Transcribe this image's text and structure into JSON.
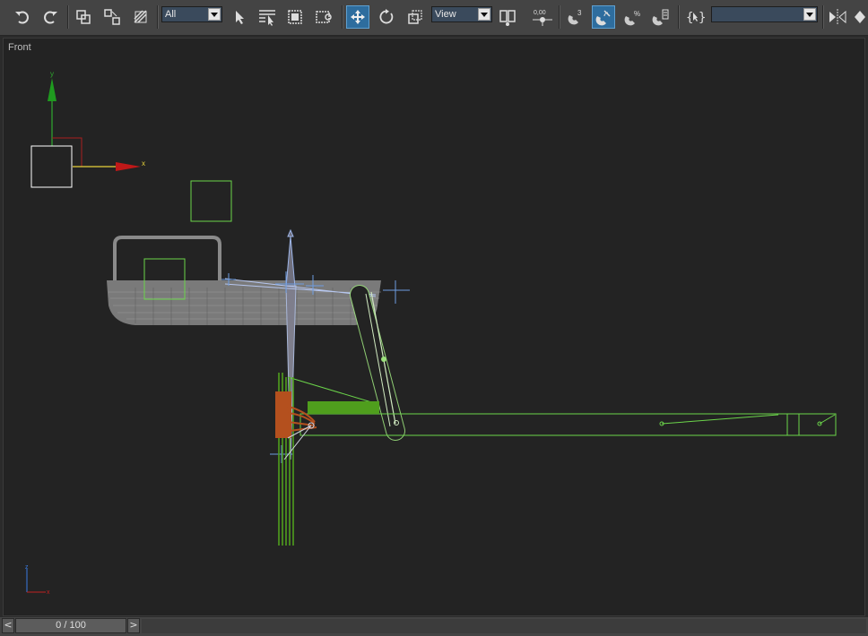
{
  "toolbar": {
    "selection_filter": "All",
    "reference_coord": "View",
    "spinner_value": "0,00",
    "named_selection": "",
    "items": [
      {
        "id": "undo",
        "icon": "undo-icon"
      },
      {
        "id": "redo",
        "icon": "redo-icon"
      },
      {
        "id": "link",
        "icon": "link-icon"
      },
      {
        "id": "unlink",
        "icon": "unlink-icon"
      },
      {
        "id": "bind-space-warp",
        "icon": "bind-space-warp-icon"
      },
      {
        "id": "select-object",
        "icon": "select-arrow-icon"
      },
      {
        "id": "select-by-name",
        "icon": "select-by-name-icon"
      },
      {
        "id": "region-select",
        "icon": "rectangular-region-icon"
      },
      {
        "id": "window-crossing",
        "icon": "window-crossing-icon"
      },
      {
        "id": "select-move",
        "icon": "move-icon",
        "active": true
      },
      {
        "id": "select-rotate",
        "icon": "rotate-icon"
      },
      {
        "id": "select-scale",
        "icon": "scale-icon"
      },
      {
        "id": "use-pivot",
        "icon": "pivot-center-icon"
      },
      {
        "id": "manipulate",
        "icon": "manipulate-icon"
      },
      {
        "id": "snaps-toggle",
        "icon": "snap-3-icon"
      },
      {
        "id": "angle-snap",
        "icon": "angle-snap-icon",
        "active": true
      },
      {
        "id": "percent-snap",
        "icon": "percent-snap-icon"
      },
      {
        "id": "spinner-snap",
        "icon": "spinner-snap-icon"
      },
      {
        "id": "edit-named-selections",
        "icon": "named-selection-icon"
      },
      {
        "id": "mirror",
        "icon": "mirror-icon"
      },
      {
        "id": "align",
        "icon": "align-icon"
      }
    ]
  },
  "viewport": {
    "label": "Front",
    "axis_x": "x",
    "axis_y": "y"
  },
  "timeline": {
    "position": "0 / 100",
    "prev_label": "<",
    "next_label": ">"
  },
  "colors": {
    "toolbar_bg": "#444444",
    "viewport_bg": "#232323",
    "selected_wire": "#6bd44a",
    "accent_active": "#2e6d9e",
    "gray_mesh": "#8a8a8a",
    "bone_blue": "#9db5e8",
    "orange_part": "#b4501e"
  }
}
